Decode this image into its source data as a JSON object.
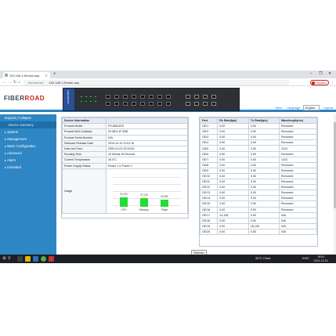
{
  "browser": {
    "tab_title": "192.168.1.8/main.asp",
    "new_tab": "+",
    "window_controls": [
      "–",
      "❐",
      "✕"
    ],
    "nav": [
      "←",
      "→",
      "↻",
      "⌂"
    ],
    "security": "Not secure",
    "url": "192.168.1.8/main.asp",
    "paused_label": "Paused",
    "menu": "⋮"
  },
  "header": {
    "logo_prefix": "FIBER",
    "logo_suffix": "ROAD",
    "device_panel_label": "FIBERROAD",
    "links": {
      "save": "Save",
      "language_label": "Language",
      "language_value": "English",
      "logout": "Logout"
    }
  },
  "sidebar": {
    "items": [
      {
        "label": "Expand | Collapse",
        "sub": false
      },
      {
        "label": "Device Summary",
        "sub": true
      },
      {
        "label": "▸ System",
        "sub": false
      },
      {
        "label": "▸ Management",
        "sub": false
      },
      {
        "label": "▸ Basic Configuration",
        "sub": false
      },
      {
        "label": "▸ Advanced",
        "sub": false
      },
      {
        "label": "▸ Alarm",
        "sub": false
      },
      {
        "label": "▸ Extended",
        "sub": false
      }
    ]
  },
  "device_info": {
    "header": [
      "Device Information",
      ""
    ],
    "rows": [
      [
        "Product Model",
        "FR-8M24GS"
      ],
      [
        "Product MAC Address",
        "00:0B:0:1F:D58"
      ],
      [
        "Product Serial Number",
        "N/A"
      ],
      [
        "Software Release Date",
        "2019-12-10 11:01:16"
      ],
      [
        "Date and Time",
        "2000-01-01 00:20:50"
      ],
      [
        "Running Time",
        "20 Minute 50 Second"
      ],
      [
        "Current Temperature",
        "35.0°C"
      ],
      [
        "Power Supply Status",
        "Power 1 & Power 2"
      ]
    ],
    "usage_label": "Usage"
  },
  "chart_data": {
    "type": "bar",
    "categories": [
      "CPU",
      "Memory",
      "Flash"
    ],
    "values": [
      31.2,
      27.7,
      23.9
    ],
    "value_labels": [
      "31.2%",
      "27.7%",
      "23.9%"
    ],
    "ylim": [
      0,
      100
    ],
    "color": "#22dd33"
  },
  "ports": {
    "headers": [
      "Port",
      "Rx Rate(bps)",
      "Tx Rate(bps)",
      "Wavelength(nm)"
    ],
    "rows": [
      [
        "GE/1",
        "0.00",
        "0.00",
        "Removed"
      ],
      [
        "GE/2",
        "0.00",
        "0.00",
        "Removed"
      ],
      [
        "GE/3",
        "0.00",
        "0.00",
        "Removed"
      ],
      [
        "GE/4",
        "0.00",
        "0.00",
        "Removed"
      ],
      [
        "GE/5",
        "0.00",
        "0.00",
        "1310"
      ],
      [
        "GE/6",
        "0.00",
        "0.00",
        "Removed"
      ],
      [
        "GE/7",
        "0.00",
        "0.00",
        "1310"
      ],
      [
        "GE/8",
        "0.00",
        "0.00",
        "Removed"
      ],
      [
        "GE/9",
        "0.00",
        "0.00",
        "Removed"
      ],
      [
        "GE/10",
        "0.00",
        "0.00",
        "Removed"
      ],
      [
        "GE/11",
        "0.00",
        "0.00",
        "Removed"
      ],
      [
        "GE/12",
        "0.00",
        "0.00",
        "Removed"
      ],
      [
        "GE/13",
        "0.00",
        "0.00",
        "Removed"
      ],
      [
        "GE/14",
        "0.00",
        "0.00",
        "Removed"
      ],
      [
        "GE/15",
        "0.00",
        "0.00",
        "Removed"
      ],
      [
        "GE/16",
        "0.00",
        "0.00",
        "Removed"
      ],
      [
        "GE/17",
        "14,128",
        "0.00",
        "N/A"
      ],
      [
        "GE/18",
        "0.00",
        "0.00",
        "N/A"
      ],
      [
        "GE/19",
        "0.00",
        "18,128",
        "N/A"
      ],
      [
        "GE/20",
        "0.00",
        "0.00",
        "N/A"
      ]
    ]
  },
  "refresh_label": "Refresh",
  "taskbar": {
    "start": "⊞",
    "search": "⚲",
    "weather": "30°C  Clear",
    "tray_lang": "ENG",
    "time": "16:01",
    "date": "2021-12-01"
  }
}
